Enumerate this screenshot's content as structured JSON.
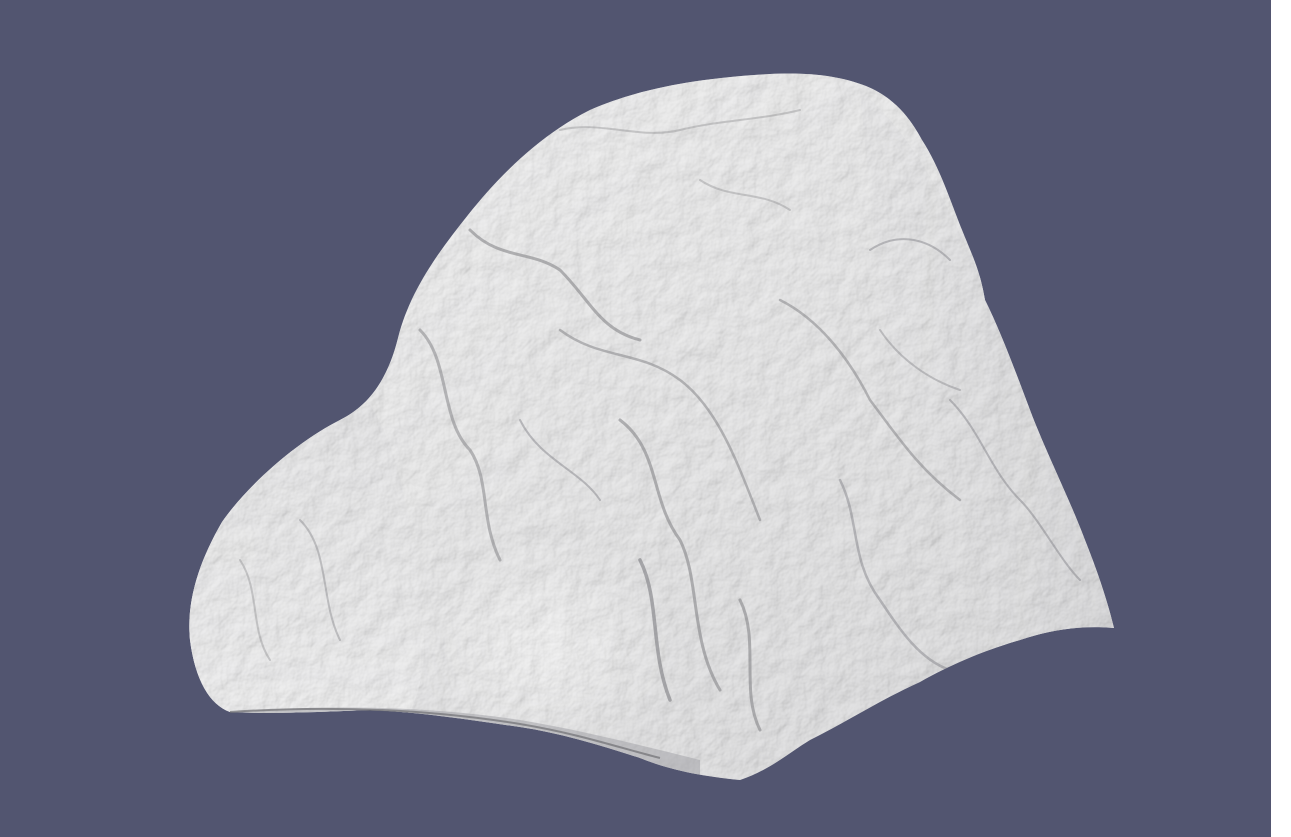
{
  "viewport": {
    "background_color": "#525570",
    "object": {
      "kind": "scanned rock mesh",
      "surface_color": "#f0f0f0",
      "shadow_color": "#6e6e74"
    }
  },
  "side_panel": {
    "color": "#ffffff"
  }
}
